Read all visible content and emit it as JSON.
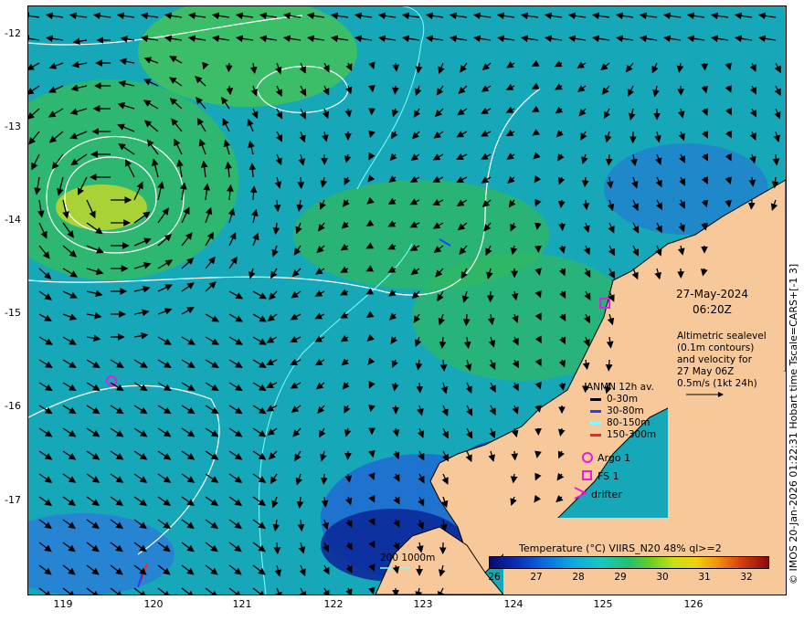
{
  "map": {
    "lat_labels": [
      "-12",
      "-13",
      "-14",
      "-15",
      "-16",
      "-17"
    ],
    "lon_labels": [
      "119",
      "120",
      "121",
      "122",
      "123",
      "124",
      "125",
      "126"
    ],
    "date": "27-May-2024",
    "time": "06:20Z",
    "altimetry_lines": [
      "Altimetric sealevel",
      "(0.1m contours)",
      "and velocity for",
      "27 May 06Z",
      "0.5m/s (1kt 24h)"
    ],
    "anmn_title": "ANMN 12h av.",
    "anmn_depths": [
      {
        "label": "0-30m",
        "color": "#000000"
      },
      {
        "label": "30-80m",
        "color": "#1f3fff"
      },
      {
        "label": "80-150m",
        "color": "#7fffff"
      },
      {
        "label": "150-300m",
        "color": "#ff2020"
      }
    ],
    "markers": {
      "argo": "Argo 1",
      "fs": "FS 1",
      "drifter": "drifter"
    },
    "marker_color": "#e020e0",
    "bathymetry_scale": "200  1000m",
    "colorbar_title": "Temperature (°C) VIIRS_N20 48% ql>=2",
    "colorbar_ticks": [
      "26",
      "27",
      "28",
      "29",
      "30",
      "31",
      "32"
    ],
    "side_caption": "© IMOS 20-Jan-2026 01:22:31 Hobart time Tscale=CARS+[-1 3]",
    "land_color": "#f7c89a"
  }
}
